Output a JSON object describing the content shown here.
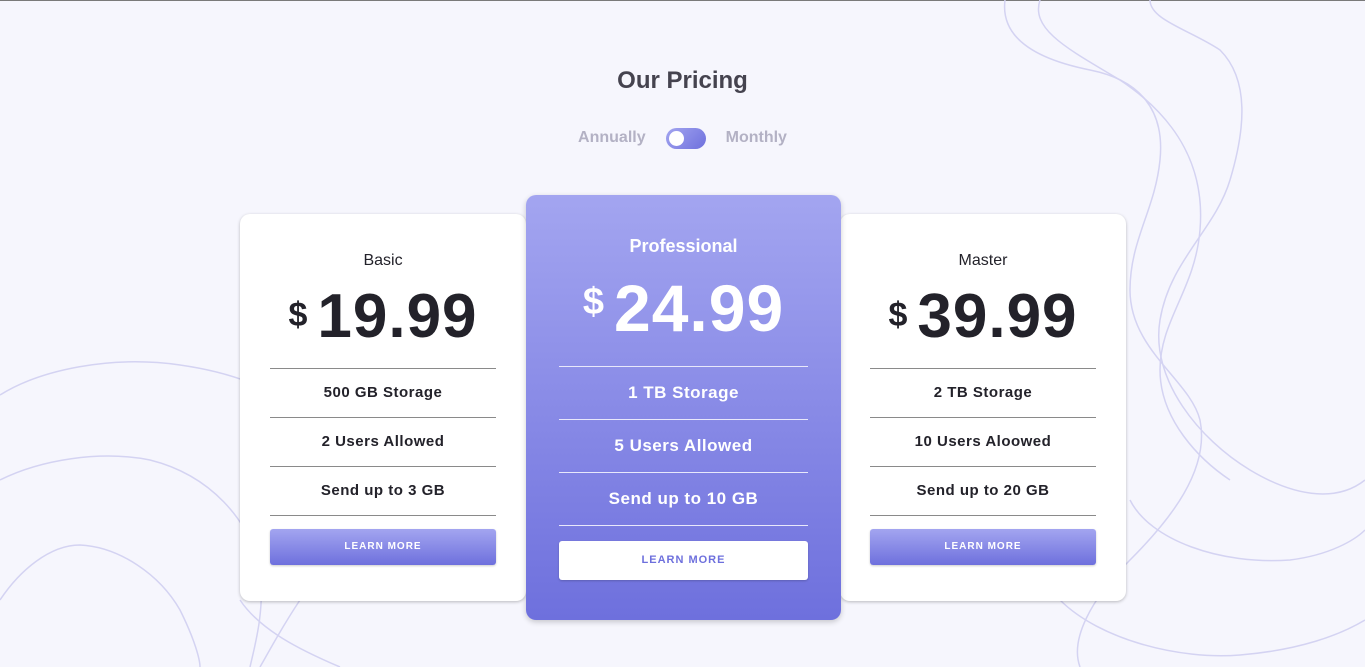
{
  "page": {
    "title": "Our Pricing",
    "toggle": {
      "left_label": "Annually",
      "right_label": "Monthly"
    }
  },
  "colors": {
    "background": "#f6f6fd",
    "accent_light": "#a3a5f0",
    "accent_dark": "#6e70dd",
    "text_dark": "#23222a",
    "muted": "#b3b1c4"
  },
  "plans": [
    {
      "name": "Basic",
      "currency": "$",
      "price": "19.99",
      "features": [
        "500 GB Storage",
        "2 Users Allowed",
        "Send up to 3 GB"
      ],
      "button": "LEARN MORE"
    },
    {
      "name": "Professional",
      "currency": "$",
      "price": "24.99",
      "features": [
        "1 TB Storage",
        "5 Users Allowed",
        "Send up to 10 GB"
      ],
      "button": "LEARN MORE"
    },
    {
      "name": "Master",
      "currency": "$",
      "price": "39.99",
      "features": [
        "2 TB Storage",
        "10 Users Aloowed",
        "Send up to 20 GB"
      ],
      "button": "LEARN MORE"
    }
  ]
}
